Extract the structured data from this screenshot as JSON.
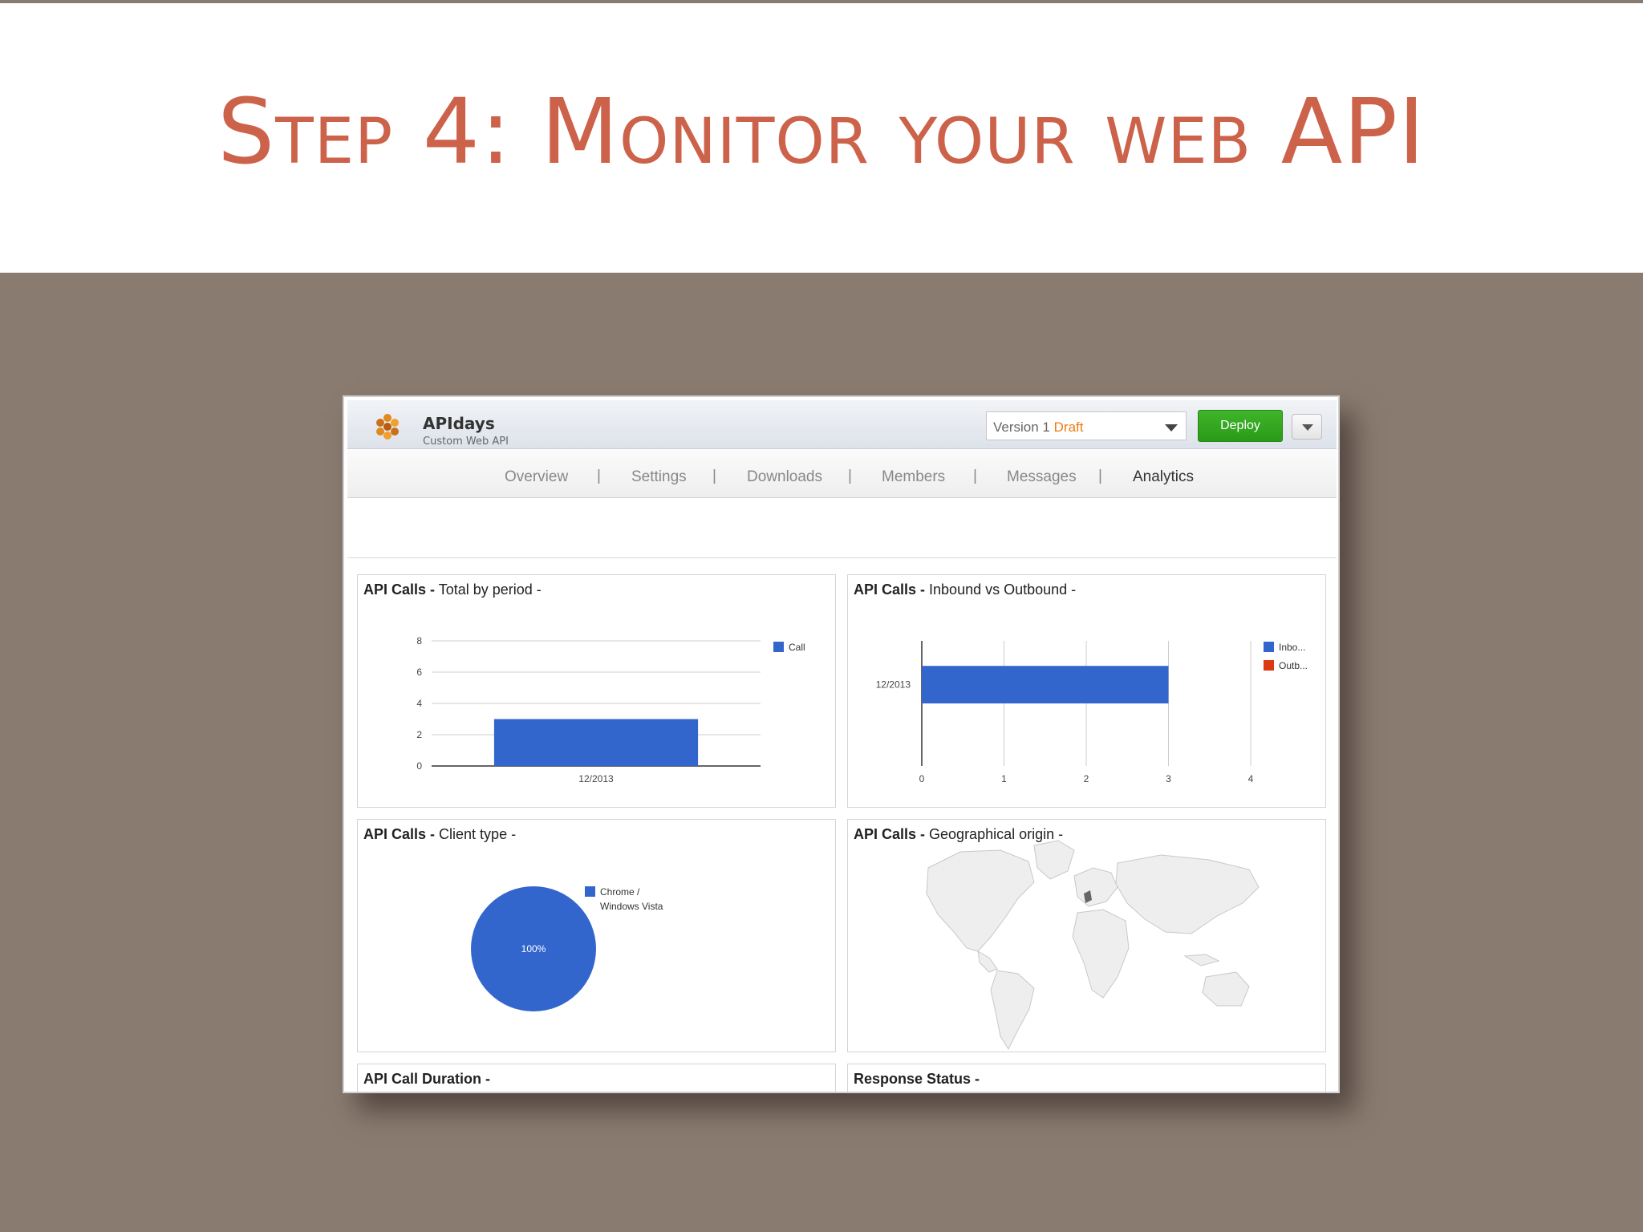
{
  "slide": {
    "title": "Step 4: Monitor your web API"
  },
  "app": {
    "name": "APIdays",
    "subtitle": "Custom Web API",
    "version_label": "Version 1",
    "version_status": "Draft",
    "deploy_label": "Deploy"
  },
  "nav": {
    "items": [
      "Overview",
      "Settings",
      "Downloads",
      "Members",
      "Messages",
      "Analytics"
    ],
    "separator": "|",
    "active": "Analytics"
  },
  "panels": {
    "total_by_period": {
      "title_bold": "API Calls -",
      "title_rest": " Total by period -"
    },
    "inbound_outbound": {
      "title_bold": "API Calls -",
      "title_rest": " Inbound vs Outbound -"
    },
    "client_type": {
      "title_bold": "API Calls -",
      "title_rest": " Client type -"
    },
    "geo_origin": {
      "title_bold": "API Calls -",
      "title_rest": " Geographical origin -"
    },
    "call_duration": {
      "title_bold": "API Call Duration -",
      "title_rest": ""
    },
    "response_status": {
      "title_bold": "Response Status -",
      "title_rest": ""
    }
  },
  "colors": {
    "title": "#cc624a",
    "slide_bg": "#8a7b70",
    "series_blue": "#3366cc",
    "series_red": "#dc3912",
    "deploy_green": "#2ea41c",
    "draft_orange": "#f07a12"
  },
  "chart_data": [
    {
      "type": "bar",
      "categories": [
        "12/2013"
      ],
      "series": [
        {
          "name": "Call",
          "values": [
            3
          ]
        }
      ],
      "ylim": [
        0,
        8
      ],
      "yticks": [
        "0",
        "2",
        "4",
        "6",
        "8"
      ],
      "legend": "right"
    },
    {
      "type": "bar",
      "orientation": "horizontal",
      "categories": [
        "12/2013"
      ],
      "series": [
        {
          "name": "Inbo...",
          "values": [
            3
          ]
        },
        {
          "name": "Outb...",
          "values": [
            0
          ]
        }
      ],
      "xlim": [
        0,
        4
      ],
      "xticks": [
        "0",
        "1",
        "2",
        "3",
        "4"
      ],
      "legend": "right"
    },
    {
      "type": "pie",
      "slices": [
        {
          "label": "Chrome / Windows Vista",
          "value": 100,
          "display": "100%"
        }
      ],
      "legend": "right"
    }
  ],
  "icons": {
    "logo": "honeycomb-logo-icon",
    "caret": "chevron-down-icon"
  }
}
